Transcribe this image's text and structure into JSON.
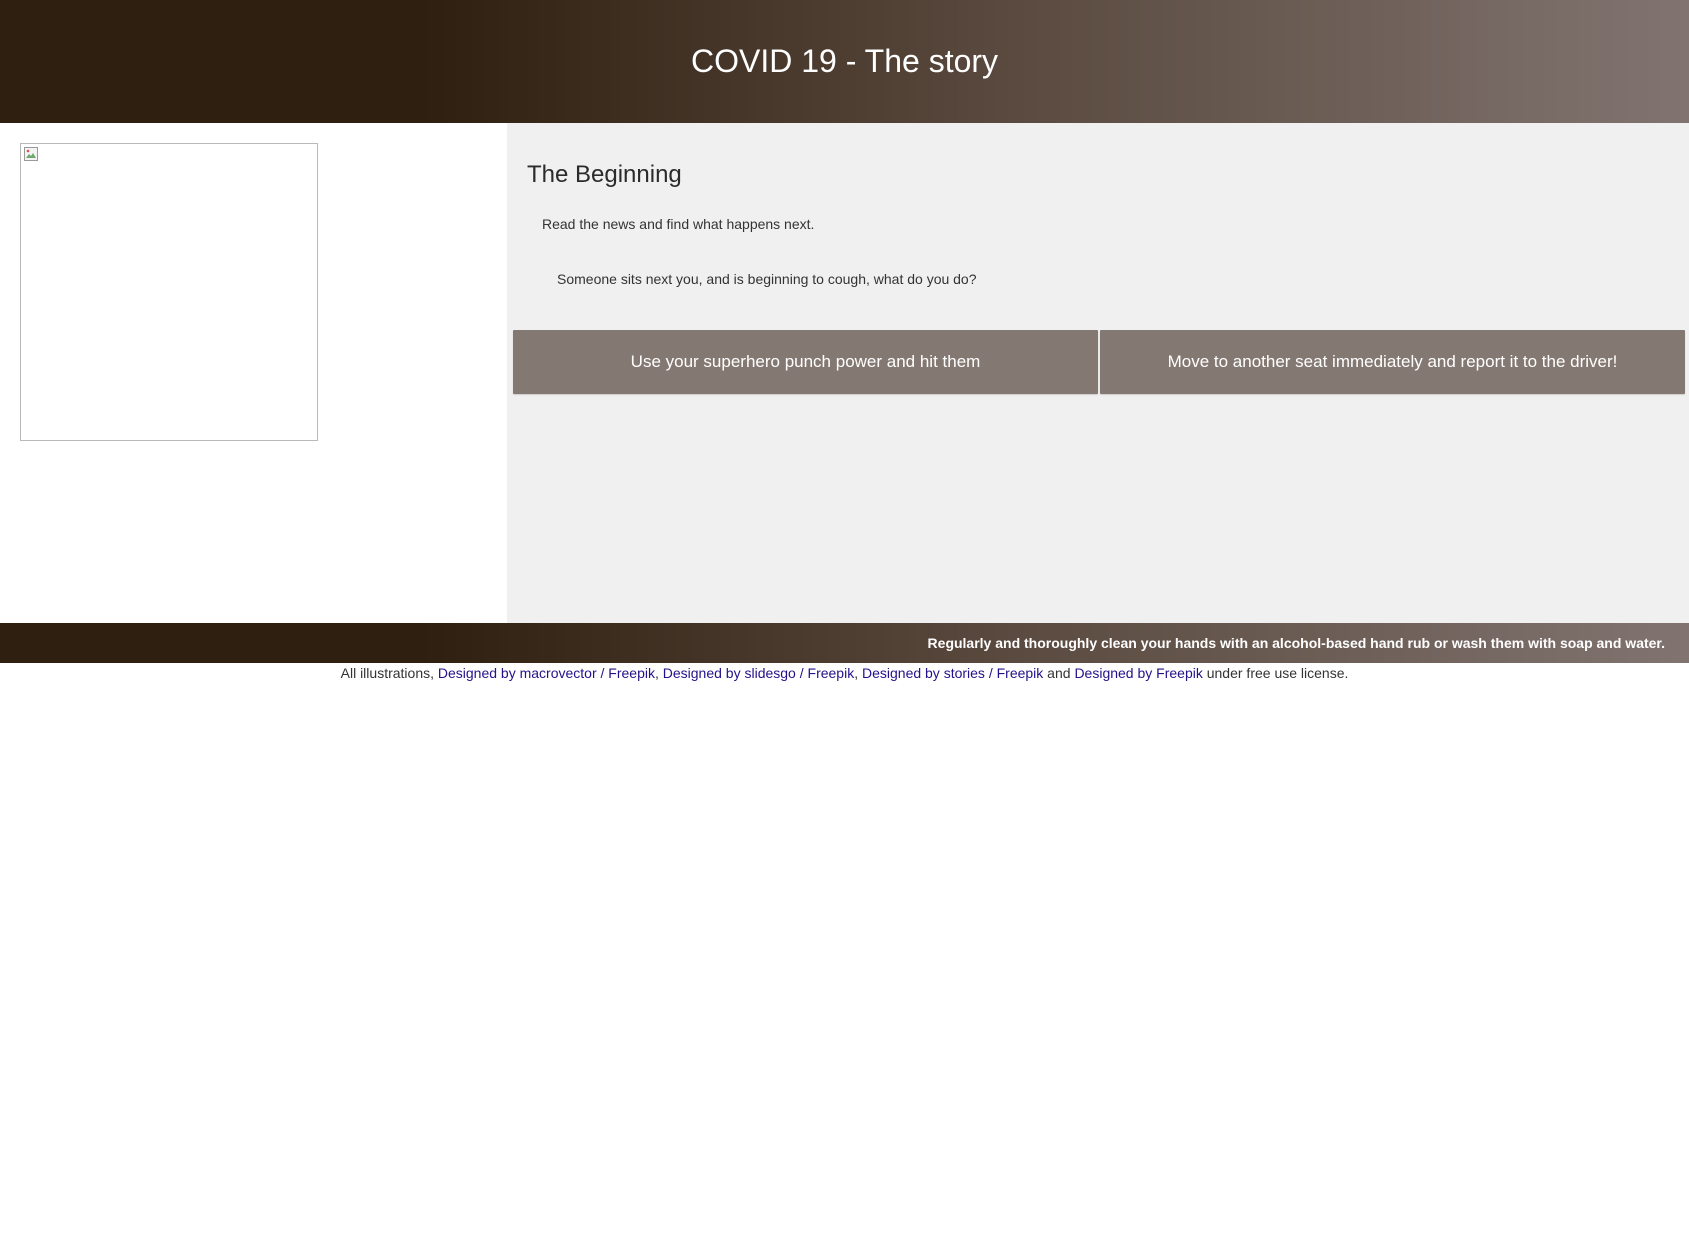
{
  "header": {
    "title": "COVID 19 - The story"
  },
  "story": {
    "section_title": "The Beginning",
    "intro": "Read the news and find what happens next.",
    "question": "Someone sits next you, and is beginning to cough, what do you do?",
    "choices": [
      {
        "label": "Use your superhero punch power and hit them"
      },
      {
        "label": "Move to another seat immediately and report it to the driver!"
      }
    ]
  },
  "footer": {
    "tip": "Regularly and thoroughly clean your hands with an alcohol-based hand rub or wash them with soap and water."
  },
  "credits": {
    "prefix": "All illustrations, ",
    "link1": "Designed by macrovector / Freepik",
    "sep1": ", ",
    "link2": "Designed by slidesgo / Freepik",
    "sep2": ", ",
    "link3": "Designed by stories / Freepik",
    "sep3": " and ",
    "link4": "Designed by Freepik",
    "suffix": " under free use license."
  }
}
